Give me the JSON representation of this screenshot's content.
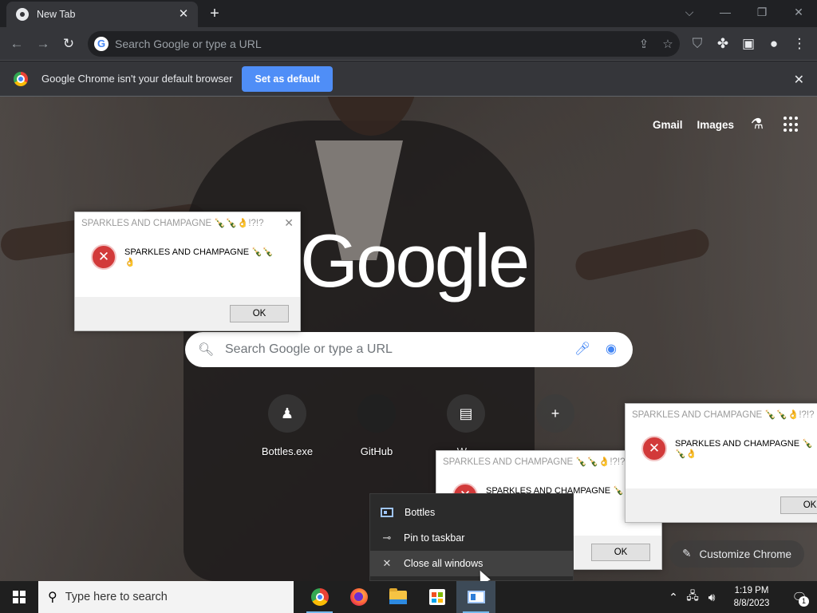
{
  "browser": {
    "tab": {
      "title": "New Tab",
      "close_icon": "close-icon"
    },
    "new_tab_label": "+",
    "window_controls": {
      "tab_search": "⌵",
      "minimize": "—",
      "restore": "❐",
      "close": "✕"
    },
    "omnibox": {
      "placeholder": "Search Google or type a URL"
    },
    "infobar": {
      "message": "Google Chrome isn't your default browser",
      "button": "Set as default"
    }
  },
  "ntp": {
    "links": {
      "gmail": "Gmail",
      "images": "Images"
    },
    "logo": "Google",
    "search_placeholder": "Search Google or type a URL",
    "shortcuts": [
      {
        "label": "Bottles.exe",
        "icon": "bottles-shortcut-icon"
      },
      {
        "label": "GitHub",
        "icon": "github-icon"
      },
      {
        "label": "W...",
        "icon": "web-icon"
      },
      {
        "label": "",
        "icon": "add-icon"
      }
    ],
    "customize_label": "Customize Chrome"
  },
  "dialogs": [
    {
      "title": "SPARKLES AND CHAMPAGNE 🍾🍾👌!?!?",
      "message": "SPARKLES AND CHAMPAGNE 🍾🍾👌",
      "ok": "OK"
    },
    {
      "title": "SPARKLES AND CHAMPAGNE 🍾🍾👌!?!?",
      "message": "SPARKLES AND CHAMPAGNE 🍾🍾👌",
      "ok": "OK"
    },
    {
      "title": "SPARKLES AND CHAMPAGNE 🍾🍾👌!?!?",
      "message": "SPARKLES AND CHAMPAGNE 🍾🍾👌",
      "ok": "OK"
    }
  ],
  "jumplist": {
    "items": [
      {
        "label": "Bottles"
      },
      {
        "label": "Pin to taskbar"
      },
      {
        "label": "Close all windows"
      }
    ]
  },
  "taskbar": {
    "search_placeholder": "Type here to search",
    "time": "1:19 PM",
    "date": "8/8/2023",
    "notification_count": "1"
  }
}
